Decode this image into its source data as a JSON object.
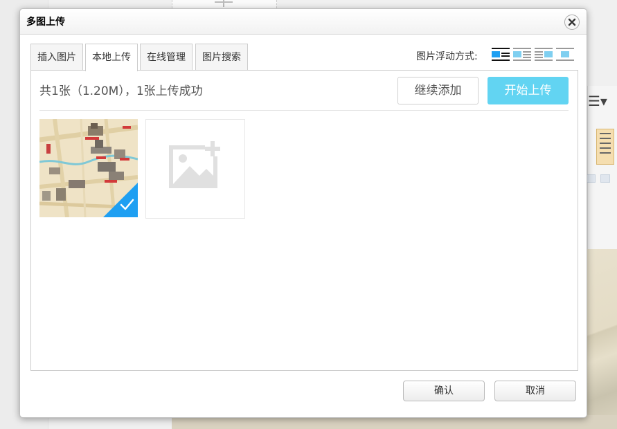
{
  "dialog": {
    "title": "多图上传",
    "close_icon": "close-icon"
  },
  "tabs": [
    {
      "label": "插入图片",
      "active": false
    },
    {
      "label": "本地上传",
      "active": true
    },
    {
      "label": "在线管理",
      "active": false
    },
    {
      "label": "图片搜索",
      "active": false
    }
  ],
  "float_mode": {
    "label": "图片浮动方式:",
    "options": [
      {
        "icon": "float-none-icon",
        "selected": true
      },
      {
        "icon": "float-left-icon",
        "selected": false
      },
      {
        "icon": "float-right-icon",
        "selected": false
      },
      {
        "icon": "float-center-icon",
        "selected": false
      }
    ]
  },
  "upload": {
    "status_text": "共1张（1.20M），1张上传成功",
    "continue_add_label": "继续添加",
    "start_upload_label": "开始上传",
    "files": [
      {
        "thumbnail": "map-thumbnail",
        "uploaded": true
      }
    ],
    "add_slot_icon": "add-image-icon"
  },
  "footer": {
    "confirm_label": "确认",
    "cancel_label": "取消"
  },
  "colors": {
    "accent": "#1e9ff2",
    "start_button": "#62d4f2"
  }
}
